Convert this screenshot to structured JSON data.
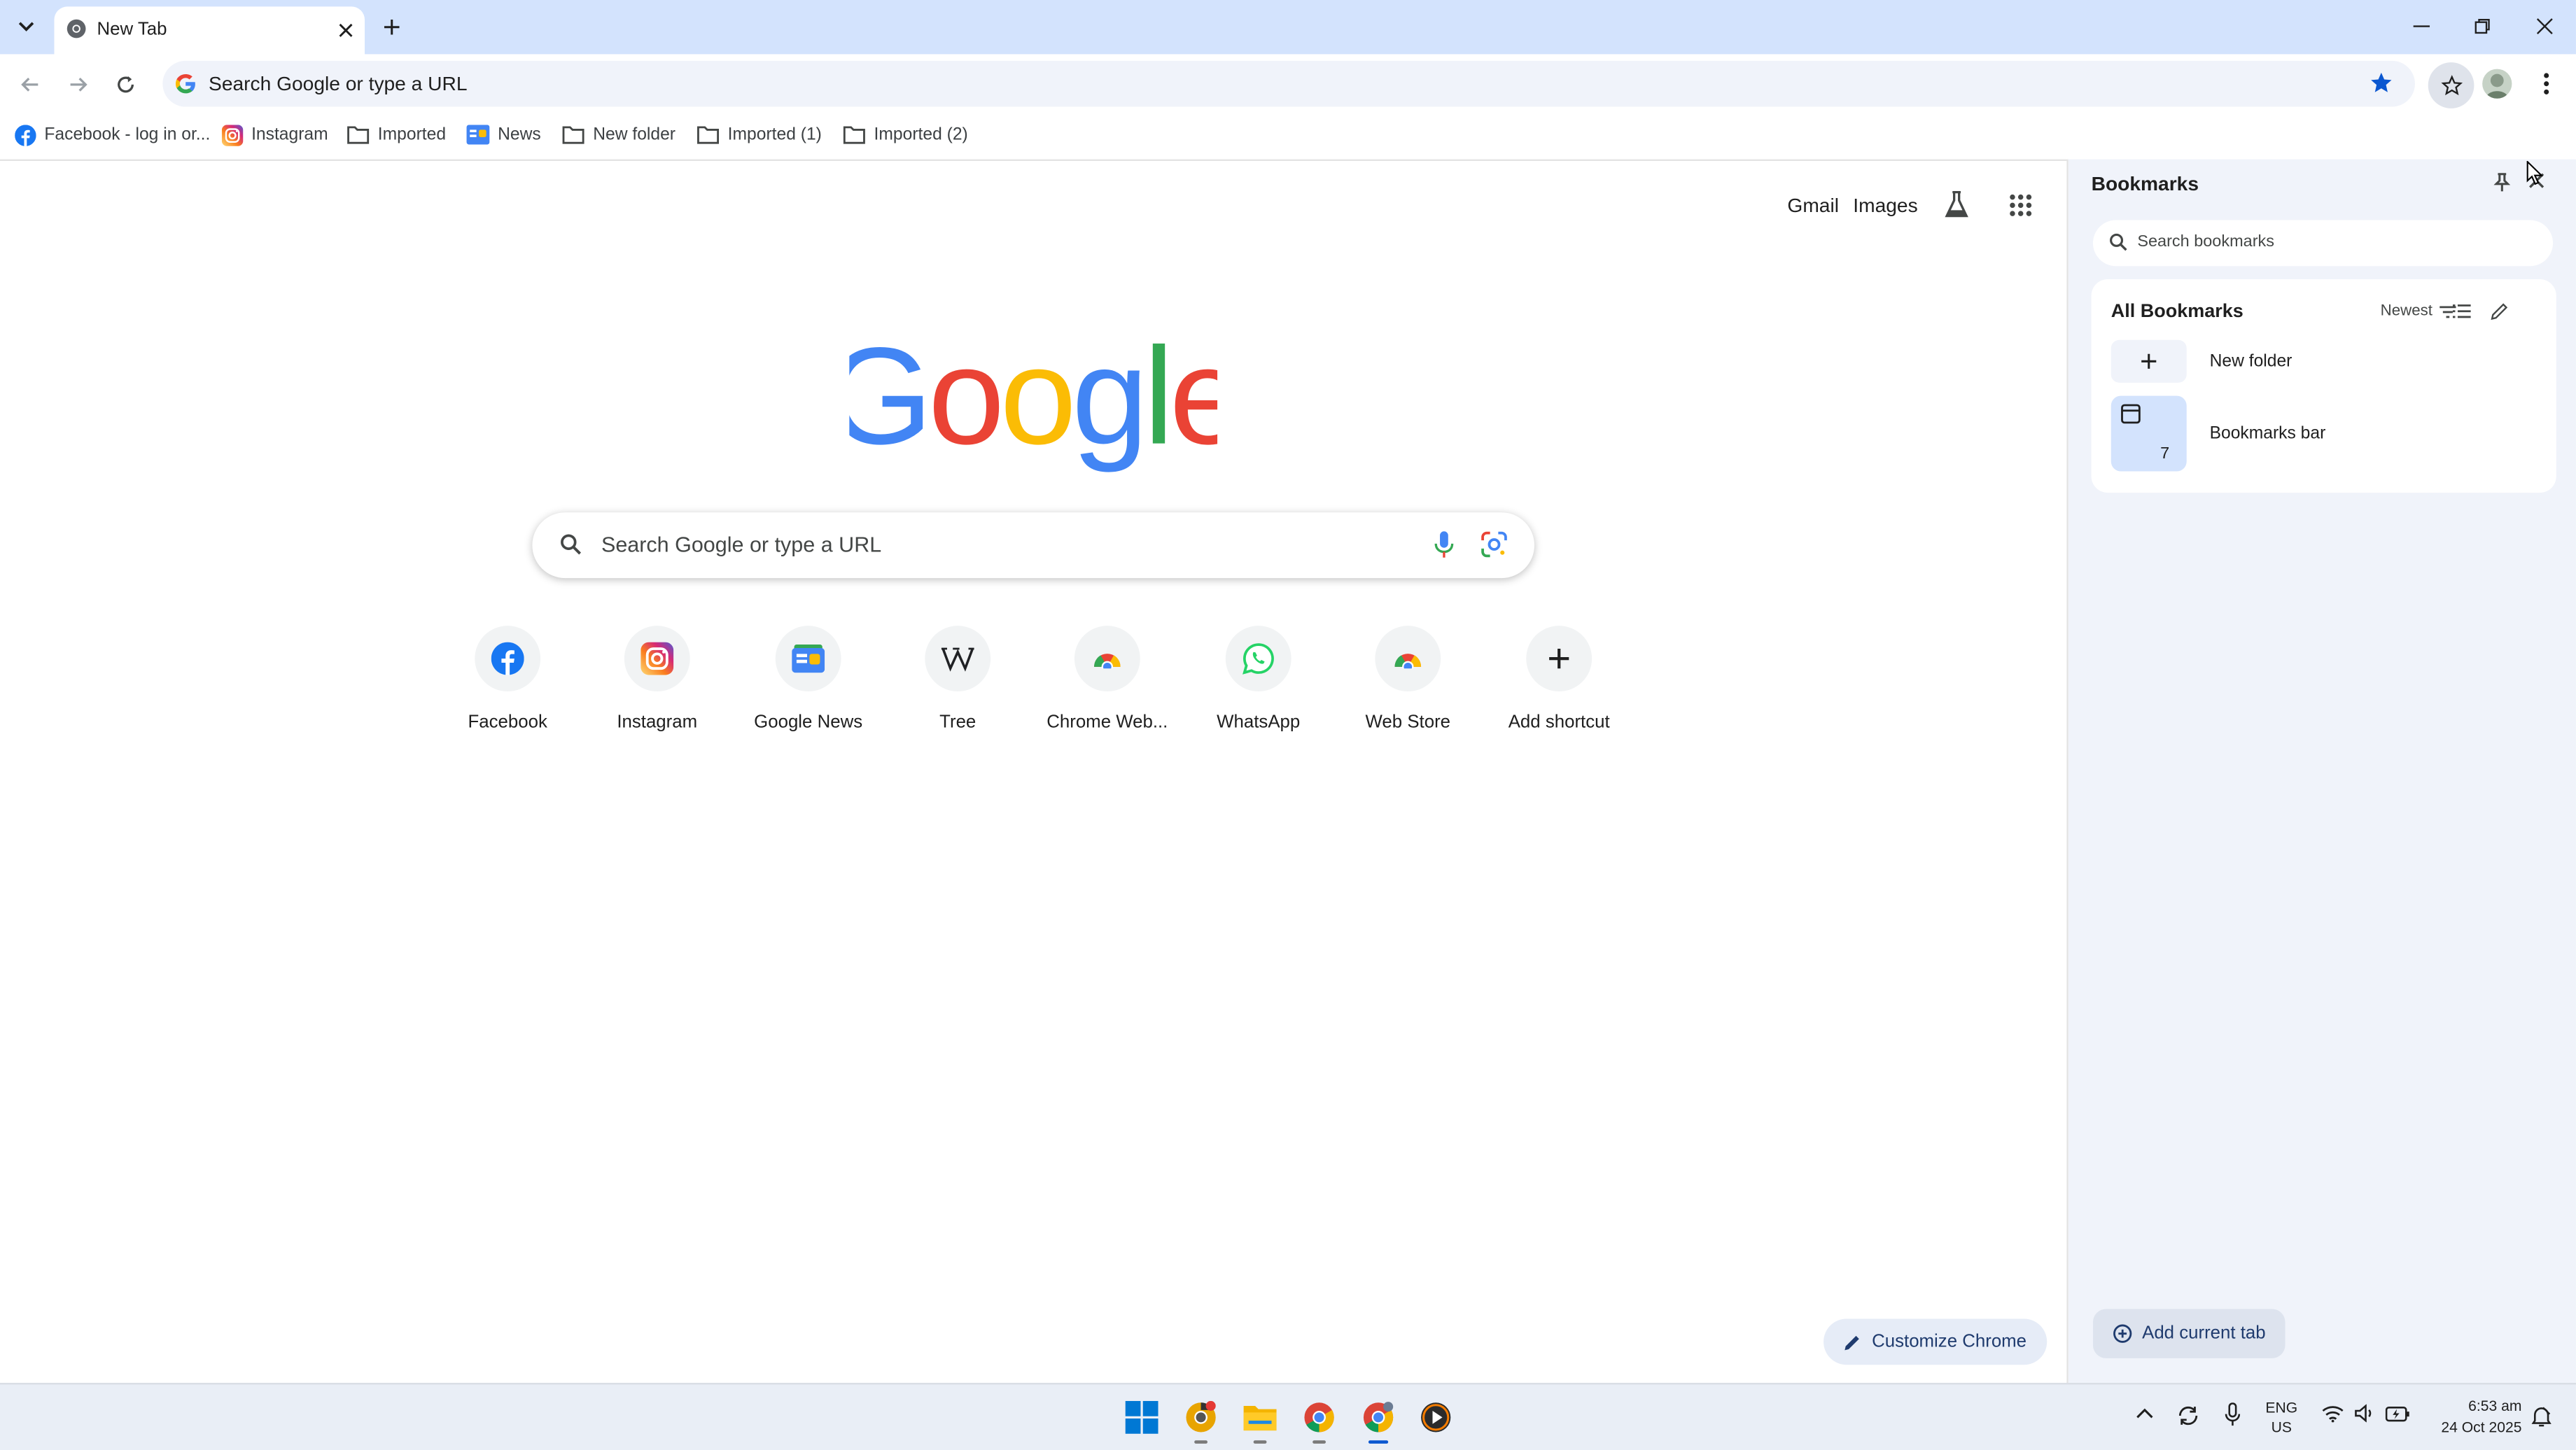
{
  "window": {
    "tab_title": "New Tab",
    "icons": [
      "tab-search-icon",
      "chrome-icon",
      "close-icon",
      "plus-icon",
      "minimize-icon",
      "restore-icon",
      "close-icon"
    ]
  },
  "toolbar": {
    "omnibox_text": "Search Google or type a URL",
    "icons": [
      "back-icon",
      "forward-icon",
      "reload-icon",
      "google-g-icon",
      "star-icon",
      "bookmarks-panel-icon",
      "avatar",
      "more-vert-icon"
    ]
  },
  "bookmarks_bar": [
    {
      "label": "Facebook - log in or...",
      "icon": "facebook-icon"
    },
    {
      "label": "Instagram",
      "icon": "instagram-icon"
    },
    {
      "label": "Imported",
      "icon": "folder-icon"
    },
    {
      "label": "News",
      "icon": "google-news-icon"
    },
    {
      "label": "New folder",
      "icon": "folder-icon"
    },
    {
      "label": "Imported (1)",
      "icon": "folder-icon"
    },
    {
      "label": "Imported (2)",
      "icon": "folder-icon"
    }
  ],
  "ntp": {
    "gmail": "Gmail",
    "images": "Images",
    "search_placeholder": "Search Google or type a URL",
    "logo_letters": [
      "G",
      "o",
      "o",
      "g",
      "l",
      "e"
    ],
    "logo_colors": [
      "#4285f4",
      "#ea4335",
      "#fbbc05",
      "#4285f4",
      "#34a853",
      "#ea4335"
    ],
    "shortcuts": [
      {
        "label": "Facebook",
        "icon": "facebook-icon"
      },
      {
        "label": "Instagram",
        "icon": "instagram-icon"
      },
      {
        "label": "Google News",
        "icon": "google-news-icon"
      },
      {
        "label": "Tree",
        "icon": "wikipedia-icon"
      },
      {
        "label": "Chrome Web...",
        "icon": "chrome-web-store-icon"
      },
      {
        "label": "WhatsApp",
        "icon": "whatsapp-icon"
      },
      {
        "label": "Web Store",
        "icon": "chrome-web-store-icon"
      },
      {
        "label": "Add shortcut",
        "icon": "plus-icon"
      }
    ],
    "customize_label": "Customize Chrome"
  },
  "side_panel": {
    "title": "Bookmarks",
    "search_placeholder": "Search bookmarks",
    "all_bookmarks": "All Bookmarks",
    "sort_label": "Newest",
    "rows": [
      {
        "label": "New folder",
        "icon": "plus-icon"
      },
      {
        "label": "Bookmarks bar",
        "icon": "bookmarks-bar-icon",
        "count": "7"
      }
    ],
    "add_current_tab": "Add current tab"
  },
  "taskbar": {
    "apps": [
      "windows-start-icon",
      "chrome-canary-icon",
      "file-explorer-icon",
      "chrome-icon",
      "chrome-beta-icon",
      "media-player-icon"
    ],
    "lang_top": "ENG",
    "lang_bottom": "US",
    "time": "6:53 am",
    "date": "24 Oct 2025"
  },
  "colors": {
    "tab_strip": "#d3e3fd",
    "accent": "#0b57d0",
    "side_panel_bg": "#f0f3fa"
  }
}
